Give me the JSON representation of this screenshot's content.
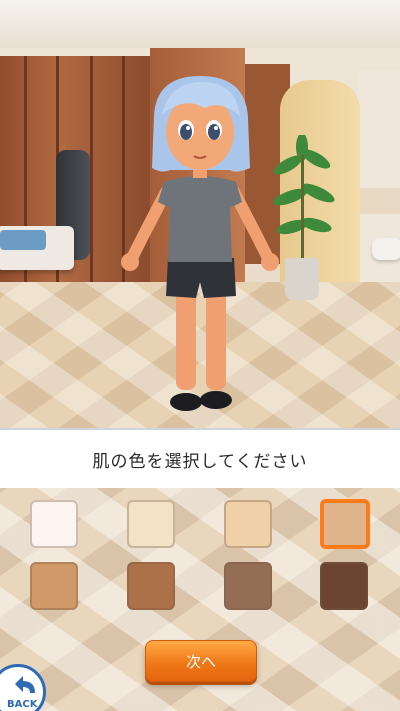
{
  "prompt": "肌の色を選択してください",
  "skin_tones": [
    {
      "color": "#fdf3ef",
      "selected": false
    },
    {
      "color": "#f3e2c6",
      "selected": false
    },
    {
      "color": "#efd0a8",
      "selected": false
    },
    {
      "color": "#e0b48a",
      "selected": true
    },
    {
      "color": "#d09a68",
      "selected": false
    },
    {
      "color": "#ad7149",
      "selected": false
    },
    {
      "color": "#936e55",
      "selected": false
    },
    {
      "color": "#6b4531",
      "selected": false
    }
  ],
  "next_button": "次へ",
  "back_button": "BACK",
  "accent_color": "#ff7a1a",
  "icons": {
    "back": "back-arrow-icon"
  }
}
